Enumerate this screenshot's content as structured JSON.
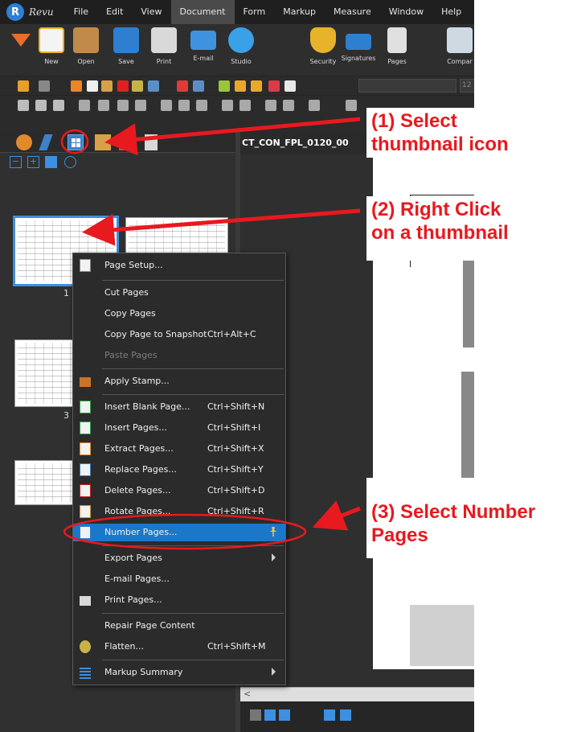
{
  "app": {
    "brand": "Revu",
    "menus": [
      "File",
      "Edit",
      "View",
      "Document",
      "Form",
      "Markup",
      "Measure",
      "Window",
      "Help"
    ],
    "active_menu": "Document"
  },
  "ribbon": {
    "buttons": [
      {
        "label": "New",
        "icon": "new-document-icon"
      },
      {
        "label": "Open",
        "icon": "folder-open-icon"
      },
      {
        "label": "Save",
        "icon": "save-disk-icon"
      },
      {
        "label": "Print",
        "icon": "printer-icon"
      },
      {
        "label": "E-mail",
        "icon": "envelope-icon"
      },
      {
        "label": "Studio",
        "icon": "studio-cube-icon"
      },
      {
        "label": "Security",
        "icon": "shield-icon"
      },
      {
        "label": "Signatures",
        "icon": "signature-pen-icon"
      },
      {
        "label": "Pages",
        "icon": "pages-stack-icon"
      },
      {
        "label": "Compar",
        "icon": "compare-icon"
      }
    ]
  },
  "toolbar": {
    "font_size": "12"
  },
  "document": {
    "tab_title": "CT_CON_FPL_0120_00"
  },
  "thumbnails": [
    {
      "number": "1",
      "selected": true
    },
    {
      "number": "3",
      "selected": false
    }
  ],
  "context_menu": {
    "items": [
      {
        "label": "Page Setup...",
        "shortcut": "",
        "icon": "page-setup-icon"
      },
      {
        "label": "Cut Pages",
        "shortcut": ""
      },
      {
        "label": "Copy Pages",
        "shortcut": ""
      },
      {
        "label": "Copy Page to Snapshot",
        "shortcut": "Ctrl+Alt+C"
      },
      {
        "label": "Paste Pages",
        "shortcut": "",
        "disabled": true
      },
      {
        "label": "Apply Stamp...",
        "shortcut": "",
        "icon": "stamp-icon"
      },
      {
        "label": "Insert Blank Page...",
        "shortcut": "Ctrl+Shift+N",
        "icon": "insert-blank-page-icon"
      },
      {
        "label": "Insert Pages...",
        "shortcut": "Ctrl+Shift+I",
        "icon": "insert-pages-icon"
      },
      {
        "label": "Extract Pages...",
        "shortcut": "Ctrl+Shift+X",
        "icon": "extract-pages-icon"
      },
      {
        "label": "Replace Pages...",
        "shortcut": "Ctrl+Shift+Y",
        "icon": "replace-pages-icon"
      },
      {
        "label": "Delete Pages...",
        "shortcut": "Ctrl+Shift+D",
        "icon": "delete-pages-icon"
      },
      {
        "label": "Rotate Pages...",
        "shortcut": "Ctrl+Shift+R",
        "icon": "rotate-pages-icon"
      },
      {
        "label": "Number Pages...",
        "shortcut": "",
        "icon": "number-pages-icon",
        "highlighted": true
      },
      {
        "label": "Export Pages",
        "shortcut": "",
        "submenu": true
      },
      {
        "label": "E-mail Pages...",
        "shortcut": ""
      },
      {
        "label": "Print Pages...",
        "shortcut": "",
        "icon": "printer-icon"
      },
      {
        "label": "Repair Page Content",
        "shortcut": ""
      },
      {
        "label": "Flatten...",
        "shortcut": "Ctrl+Shift+M",
        "icon": "flatten-icon"
      },
      {
        "label": "Markup Summary",
        "shortcut": "",
        "icon": "markup-summary-icon",
        "submenu": true
      }
    ]
  },
  "annotations": {
    "step1": [
      "(1) Select",
      "thumbnail icon"
    ],
    "step2": [
      "(2) Right Click",
      "on a thumbnail"
    ],
    "step3": [
      "(3) Select Number",
      "Pages"
    ],
    "color": "#e8191f"
  }
}
